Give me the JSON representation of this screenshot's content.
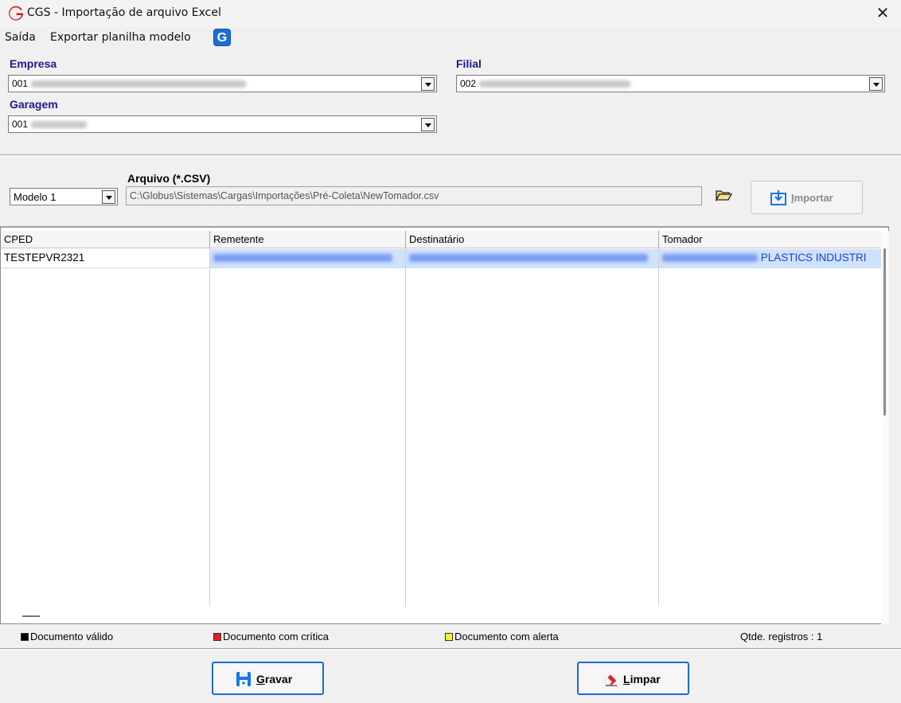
{
  "window": {
    "title": "CGS - Importação de arquivo Excel",
    "close_glyph": "✕",
    "logo_glyph": "G",
    "logo_color": "#d81e1e"
  },
  "menu": {
    "items": [
      "Saída",
      "Exportar planilha modelo"
    ],
    "globus_glyph": "G"
  },
  "filters": {
    "empresa_label": "Empresa",
    "empresa_code": "001",
    "filial_label": "Filial",
    "filial_code": "002",
    "garagem_label": "Garagem",
    "garagem_code": "001"
  },
  "import": {
    "model_value": "Modelo 1",
    "file_label": "Arquivo (*.CSV)",
    "file_path": "C:\\Globus\\Sistemas\\Cargas\\Importações\\Pré-Coleta\\NewTomador.csv",
    "import_button": {
      "mnemonic": "I",
      "rest": "mportar"
    }
  },
  "grid": {
    "columns": [
      "CPED",
      "Remetente",
      "Destinatário",
      "Tomador"
    ],
    "rows": [
      {
        "cped": "TESTEPVR2321",
        "tomador_visible": "PLASTICS INDUSTRI"
      }
    ]
  },
  "legend": {
    "valid": "Documento válido",
    "critical": "Documento com crítica",
    "alert": "Documento com alerta",
    "count": "Qtde. registros : 1"
  },
  "colors": {
    "valid": "#000000",
    "critical": "#e02020",
    "alert": "#f2f22a",
    "accent_blue": "#1e6ad3",
    "label_blue": "#1a1a8c"
  },
  "actions": {
    "save": {
      "mnemonic": "G",
      "rest": "ravar"
    },
    "clear": {
      "mnemonic": "L",
      "rest": "impar"
    }
  }
}
